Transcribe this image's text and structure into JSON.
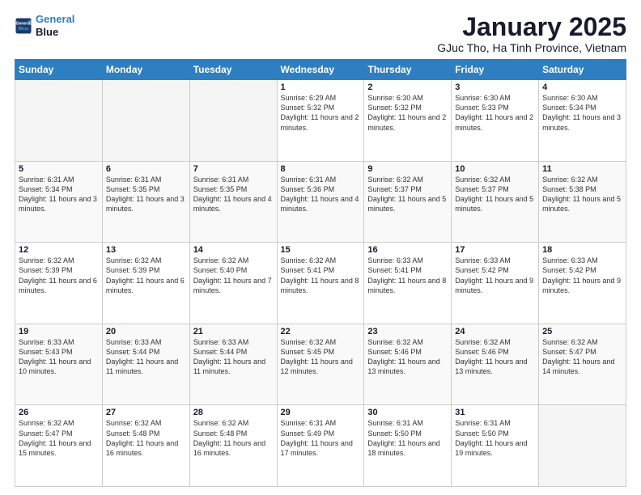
{
  "header": {
    "logo_line1": "General",
    "logo_line2": "Blue",
    "title": "January 2025",
    "subtitle": "GJuc Tho, Ha Tinh Province, Vietnam"
  },
  "days_of_week": [
    "Sunday",
    "Monday",
    "Tuesday",
    "Wednesday",
    "Thursday",
    "Friday",
    "Saturday"
  ],
  "weeks": [
    [
      {
        "day": "",
        "sunrise": "",
        "sunset": "",
        "daylight": ""
      },
      {
        "day": "",
        "sunrise": "",
        "sunset": "",
        "daylight": ""
      },
      {
        "day": "",
        "sunrise": "",
        "sunset": "",
        "daylight": ""
      },
      {
        "day": "1",
        "sunrise": "Sunrise: 6:29 AM",
        "sunset": "Sunset: 5:32 PM",
        "daylight": "Daylight: 11 hours and 2 minutes."
      },
      {
        "day": "2",
        "sunrise": "Sunrise: 6:30 AM",
        "sunset": "Sunset: 5:32 PM",
        "daylight": "Daylight: 11 hours and 2 minutes."
      },
      {
        "day": "3",
        "sunrise": "Sunrise: 6:30 AM",
        "sunset": "Sunset: 5:33 PM",
        "daylight": "Daylight: 11 hours and 2 minutes."
      },
      {
        "day": "4",
        "sunrise": "Sunrise: 6:30 AM",
        "sunset": "Sunset: 5:34 PM",
        "daylight": "Daylight: 11 hours and 3 minutes."
      }
    ],
    [
      {
        "day": "5",
        "sunrise": "Sunrise: 6:31 AM",
        "sunset": "Sunset: 5:34 PM",
        "daylight": "Daylight: 11 hours and 3 minutes."
      },
      {
        "day": "6",
        "sunrise": "Sunrise: 6:31 AM",
        "sunset": "Sunset: 5:35 PM",
        "daylight": "Daylight: 11 hours and 3 minutes."
      },
      {
        "day": "7",
        "sunrise": "Sunrise: 6:31 AM",
        "sunset": "Sunset: 5:35 PM",
        "daylight": "Daylight: 11 hours and 4 minutes."
      },
      {
        "day": "8",
        "sunrise": "Sunrise: 6:31 AM",
        "sunset": "Sunset: 5:36 PM",
        "daylight": "Daylight: 11 hours and 4 minutes."
      },
      {
        "day": "9",
        "sunrise": "Sunrise: 6:32 AM",
        "sunset": "Sunset: 5:37 PM",
        "daylight": "Daylight: 11 hours and 5 minutes."
      },
      {
        "day": "10",
        "sunrise": "Sunrise: 6:32 AM",
        "sunset": "Sunset: 5:37 PM",
        "daylight": "Daylight: 11 hours and 5 minutes."
      },
      {
        "day": "11",
        "sunrise": "Sunrise: 6:32 AM",
        "sunset": "Sunset: 5:38 PM",
        "daylight": "Daylight: 11 hours and 5 minutes."
      }
    ],
    [
      {
        "day": "12",
        "sunrise": "Sunrise: 6:32 AM",
        "sunset": "Sunset: 5:39 PM",
        "daylight": "Daylight: 11 hours and 6 minutes."
      },
      {
        "day": "13",
        "sunrise": "Sunrise: 6:32 AM",
        "sunset": "Sunset: 5:39 PM",
        "daylight": "Daylight: 11 hours and 6 minutes."
      },
      {
        "day": "14",
        "sunrise": "Sunrise: 6:32 AM",
        "sunset": "Sunset: 5:40 PM",
        "daylight": "Daylight: 11 hours and 7 minutes."
      },
      {
        "day": "15",
        "sunrise": "Sunrise: 6:32 AM",
        "sunset": "Sunset: 5:41 PM",
        "daylight": "Daylight: 11 hours and 8 minutes."
      },
      {
        "day": "16",
        "sunrise": "Sunrise: 6:33 AM",
        "sunset": "Sunset: 5:41 PM",
        "daylight": "Daylight: 11 hours and 8 minutes."
      },
      {
        "day": "17",
        "sunrise": "Sunrise: 6:33 AM",
        "sunset": "Sunset: 5:42 PM",
        "daylight": "Daylight: 11 hours and 9 minutes."
      },
      {
        "day": "18",
        "sunrise": "Sunrise: 6:33 AM",
        "sunset": "Sunset: 5:42 PM",
        "daylight": "Daylight: 11 hours and 9 minutes."
      }
    ],
    [
      {
        "day": "19",
        "sunrise": "Sunrise: 6:33 AM",
        "sunset": "Sunset: 5:43 PM",
        "daylight": "Daylight: 11 hours and 10 minutes."
      },
      {
        "day": "20",
        "sunrise": "Sunrise: 6:33 AM",
        "sunset": "Sunset: 5:44 PM",
        "daylight": "Daylight: 11 hours and 11 minutes."
      },
      {
        "day": "21",
        "sunrise": "Sunrise: 6:33 AM",
        "sunset": "Sunset: 5:44 PM",
        "daylight": "Daylight: 11 hours and 11 minutes."
      },
      {
        "day": "22",
        "sunrise": "Sunrise: 6:32 AM",
        "sunset": "Sunset: 5:45 PM",
        "daylight": "Daylight: 11 hours and 12 minutes."
      },
      {
        "day": "23",
        "sunrise": "Sunrise: 6:32 AM",
        "sunset": "Sunset: 5:46 PM",
        "daylight": "Daylight: 11 hours and 13 minutes."
      },
      {
        "day": "24",
        "sunrise": "Sunrise: 6:32 AM",
        "sunset": "Sunset: 5:46 PM",
        "daylight": "Daylight: 11 hours and 13 minutes."
      },
      {
        "day": "25",
        "sunrise": "Sunrise: 6:32 AM",
        "sunset": "Sunset: 5:47 PM",
        "daylight": "Daylight: 11 hours and 14 minutes."
      }
    ],
    [
      {
        "day": "26",
        "sunrise": "Sunrise: 6:32 AM",
        "sunset": "Sunset: 5:47 PM",
        "daylight": "Daylight: 11 hours and 15 minutes."
      },
      {
        "day": "27",
        "sunrise": "Sunrise: 6:32 AM",
        "sunset": "Sunset: 5:48 PM",
        "daylight": "Daylight: 11 hours and 16 minutes."
      },
      {
        "day": "28",
        "sunrise": "Sunrise: 6:32 AM",
        "sunset": "Sunset: 5:48 PM",
        "daylight": "Daylight: 11 hours and 16 minutes."
      },
      {
        "day": "29",
        "sunrise": "Sunrise: 6:31 AM",
        "sunset": "Sunset: 5:49 PM",
        "daylight": "Daylight: 11 hours and 17 minutes."
      },
      {
        "day": "30",
        "sunrise": "Sunrise: 6:31 AM",
        "sunset": "Sunset: 5:50 PM",
        "daylight": "Daylight: 11 hours and 18 minutes."
      },
      {
        "day": "31",
        "sunrise": "Sunrise: 6:31 AM",
        "sunset": "Sunset: 5:50 PM",
        "daylight": "Daylight: 11 hours and 19 minutes."
      },
      {
        "day": "",
        "sunrise": "",
        "sunset": "",
        "daylight": ""
      }
    ]
  ]
}
